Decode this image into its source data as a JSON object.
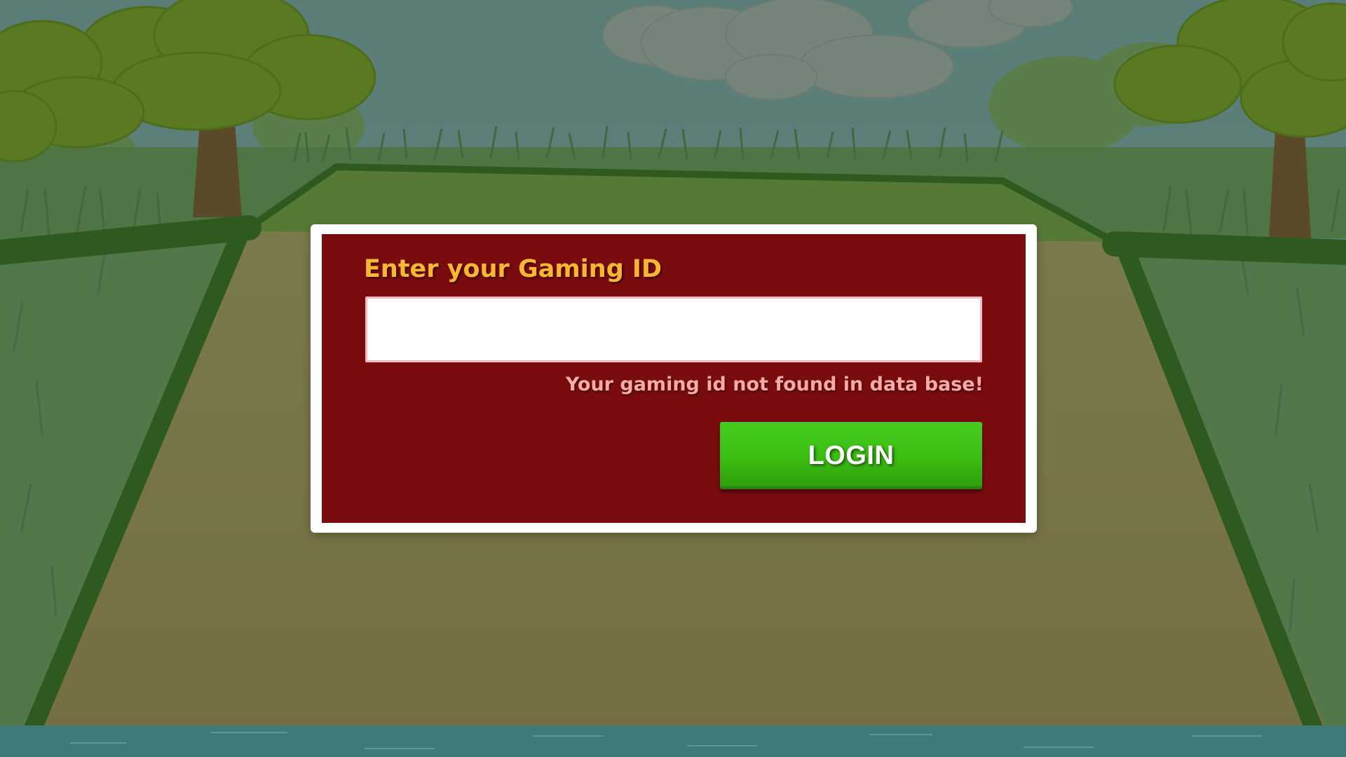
{
  "login_form": {
    "label": "Enter your Gaming ID",
    "input_value": "",
    "input_placeholder": "",
    "error_message": "Your gaming id not found in data base!",
    "login_label": "LOGIN"
  },
  "colors": {
    "panel_background": "#7a0c0e",
    "panel_border": "#ffffff",
    "label_color": "#f7b733",
    "error_color": "#f8a9a8",
    "button_color": "#3bbd12"
  }
}
